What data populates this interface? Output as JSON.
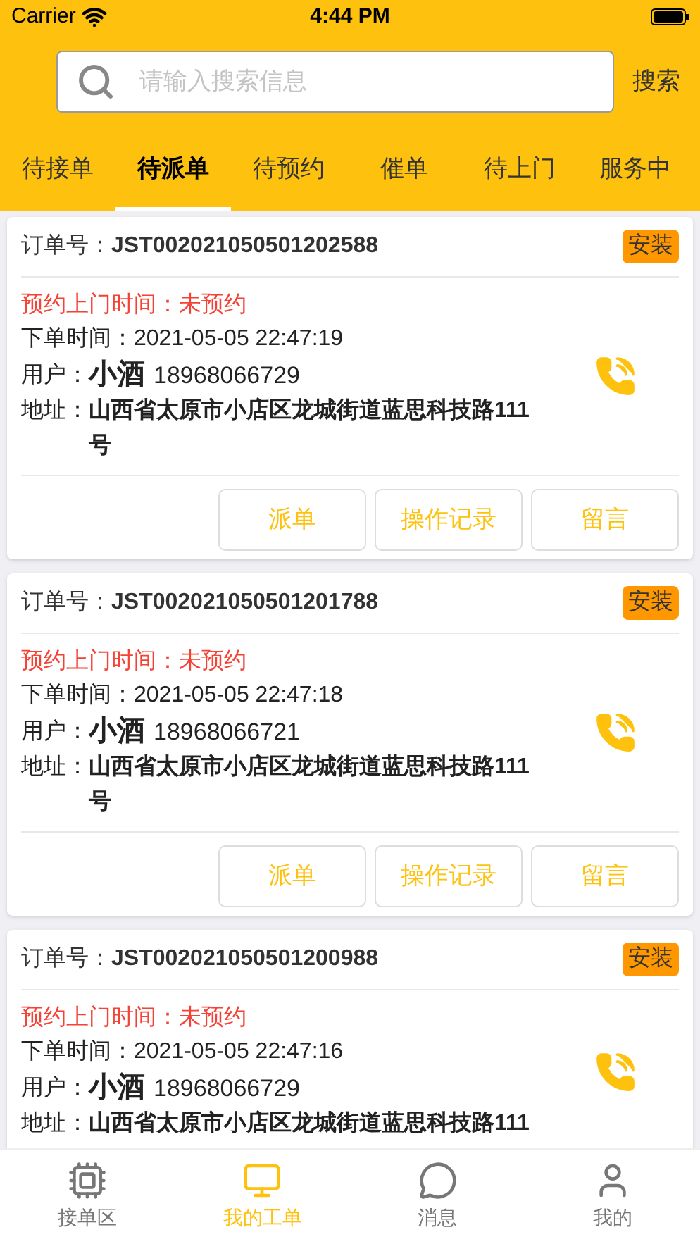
{
  "status_bar": {
    "carrier": "Carrier",
    "time": "4:44 PM"
  },
  "search": {
    "placeholder": "请输入搜索信息",
    "button": "搜索"
  },
  "tabs": [
    {
      "label": "待接单",
      "selected": false
    },
    {
      "label": "待派单",
      "selected": true
    },
    {
      "label": "待预约",
      "selected": false
    },
    {
      "label": "催单",
      "selected": false
    },
    {
      "label": "待上门",
      "selected": false
    },
    {
      "label": "服务中",
      "selected": false
    }
  ],
  "orders": [
    {
      "order_label": "订单号：",
      "order_no": "JST002021050501202588",
      "tag": "安装",
      "appointment": "预约上门时间：未预约",
      "created_label": "下单时间：",
      "created": "2021-05-05 22:47:19",
      "user_label": "用户：",
      "user_name": "小酒",
      "phone": "18968066729",
      "address_label": "地址：",
      "address": "山西省太原市小店区龙城街道蓝思科技路111号",
      "actions": [
        "派单",
        "操作记录",
        "留言"
      ]
    },
    {
      "order_label": "订单号：",
      "order_no": "JST002021050501201788",
      "tag": "安装",
      "appointment": "预约上门时间：未预约",
      "created_label": "下单时间：",
      "created": "2021-05-05 22:47:18",
      "user_label": "用户：",
      "user_name": "小酒",
      "phone": "18968066721",
      "address_label": "地址：",
      "address": "山西省太原市小店区龙城街道蓝思科技路111号",
      "actions": [
        "派单",
        "操作记录",
        "留言"
      ]
    },
    {
      "order_label": "订单号：",
      "order_no": "JST002021050501200988",
      "tag": "安装",
      "appointment": "预约上门时间：未预约",
      "created_label": "下单时间：",
      "created": "2021-05-05 22:47:16",
      "user_label": "用户：",
      "user_name": "小酒",
      "phone": "18968066729",
      "address_label": "地址：",
      "address": "山西省太原市小店区龙城街道蓝思科技路111"
    }
  ],
  "bottom_nav": [
    {
      "kind": "chip",
      "label": "接单区",
      "selected": false
    },
    {
      "kind": "monitor",
      "label": "我的工单",
      "selected": true
    },
    {
      "kind": "chat",
      "label": "消息",
      "selected": false
    },
    {
      "kind": "person",
      "label": "我的",
      "selected": false
    }
  ]
}
